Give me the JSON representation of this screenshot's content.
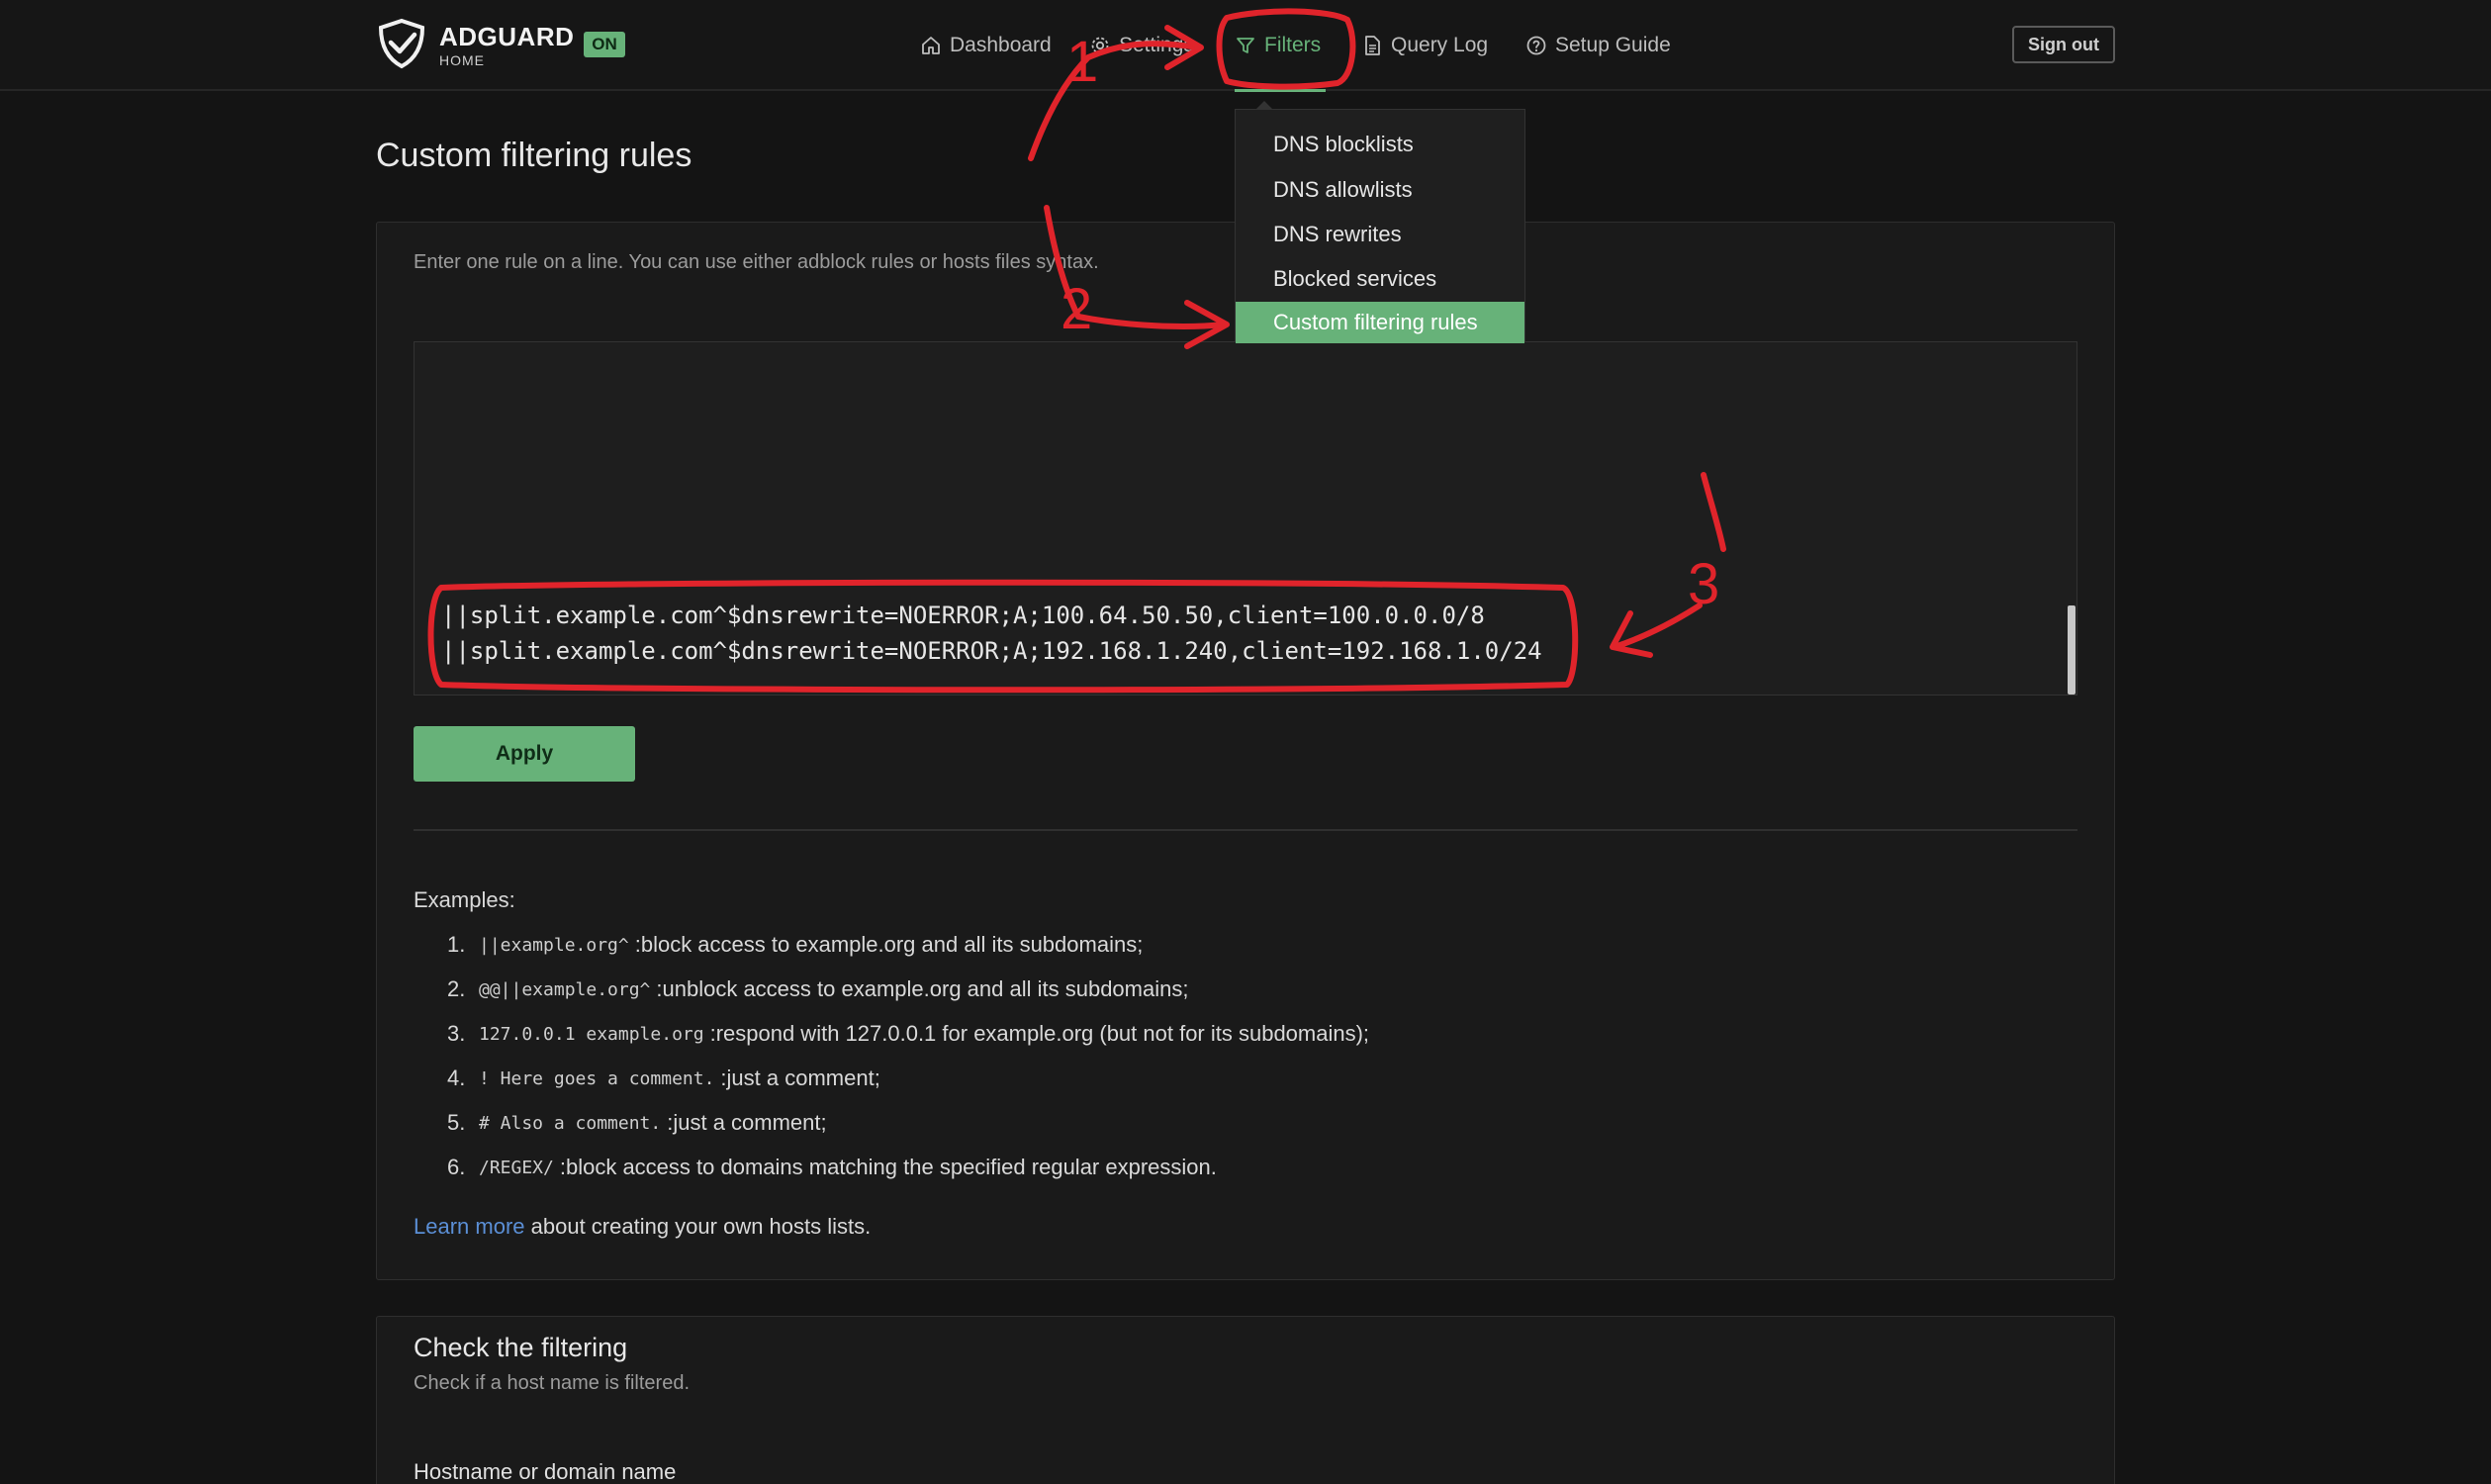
{
  "brand": {
    "title": "ADGUARD",
    "subtitle": "HOME",
    "status_badge": "ON",
    "accent_color": "#67b279",
    "logo_icon": "shield-check-icon"
  },
  "nav": {
    "dashboard": "Dashboard",
    "settings": "Settings",
    "filters": "Filters",
    "query_log": "Query Log",
    "setup_guide": "Setup Guide",
    "sign_out": "Sign out"
  },
  "filters_menu": {
    "items": [
      "DNS blocklists",
      "DNS allowlists",
      "DNS rewrites",
      "Blocked services",
      "Custom filtering rules"
    ],
    "active": "Custom filtering rules"
  },
  "page": {
    "title": "Custom filtering rules"
  },
  "rules_card": {
    "description": "Enter one rule on a line. You can use either adblock rules or hosts files syntax.",
    "rules": [
      "||split.example.com^$dnsrewrite=NOERROR;A;100.64.50.50,client=100.0.0.0/8",
      "||split.example.com^$dnsrewrite=NOERROR;A;192.168.1.240,client=192.168.1.0/24"
    ],
    "apply_label": "Apply",
    "examples_title": "Examples:",
    "examples": [
      {
        "num": "1.",
        "code": "||example.org^",
        "text": ":block access to example.org and all its subdomains;"
      },
      {
        "num": "2.",
        "code": "@@||example.org^",
        "text": ":unblock access to example.org and all its subdomains;"
      },
      {
        "num": "3.",
        "code": "127.0.0.1 example.org",
        "text": ":respond with 127.0.0.1 for example.org (but not for its subdomains);"
      },
      {
        "num": "4.",
        "code": "! Here goes a comment.",
        "text": ":just a comment;"
      },
      {
        "num": "5.",
        "code": "# Also a comment.",
        "text": ":just a comment;"
      },
      {
        "num": "6.",
        "code": "/REGEX/",
        "text": ":block access to domains matching the specified regular expression."
      }
    ],
    "learn_more_link": "Learn more",
    "learn_more_text": " about creating your own hosts lists."
  },
  "check_card": {
    "title": "Check the filtering",
    "description": "Check if a host name is filtered.",
    "hostname_label": "Hostname or domain name"
  },
  "annotations": {
    "color": "#e0242b",
    "labels": [
      "1",
      "2",
      "3"
    ]
  }
}
